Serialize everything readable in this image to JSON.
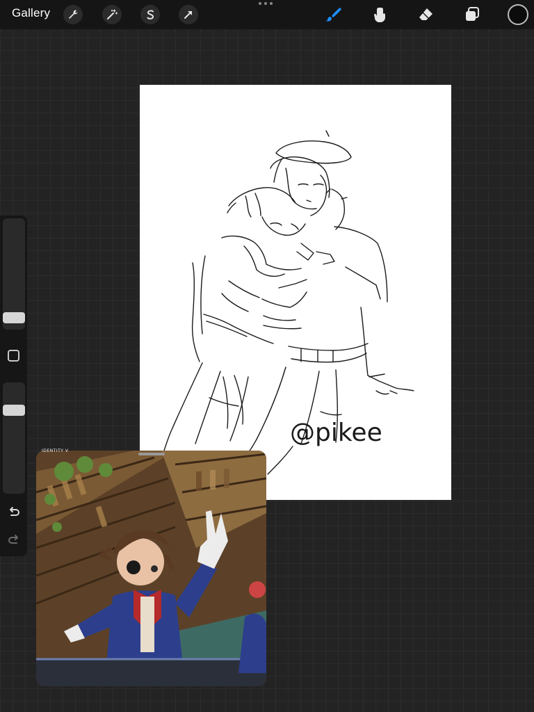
{
  "topbar": {
    "gallery_label": "Gallery",
    "left_tools": [
      {
        "name": "actions",
        "icon": "wrench-icon"
      },
      {
        "name": "adjustments",
        "icon": "magic-wand-icon"
      },
      {
        "name": "selection",
        "icon": "selection-s-icon"
      },
      {
        "name": "transform",
        "icon": "arrow-cursor-icon"
      }
    ],
    "right_tools": [
      {
        "name": "brush",
        "icon": "brush-icon",
        "active": true,
        "color": "#1e8fff"
      },
      {
        "name": "smudge",
        "icon": "smudge-icon",
        "active": false
      },
      {
        "name": "eraser",
        "icon": "eraser-icon",
        "active": false
      },
      {
        "name": "layers",
        "icon": "layers-icon",
        "active": false
      }
    ],
    "current_color": "#0c0c0c"
  },
  "canvas": {
    "watermark_text": "@pikee"
  },
  "sidebar": {
    "brush_size_level": 0.25,
    "opacity_level": 0.2,
    "modify_icon": "square-icon",
    "undo_icon": "undo-icon",
    "redo_icon": "redo-icon"
  },
  "reference": {
    "caption": "IDENTITY V"
  }
}
